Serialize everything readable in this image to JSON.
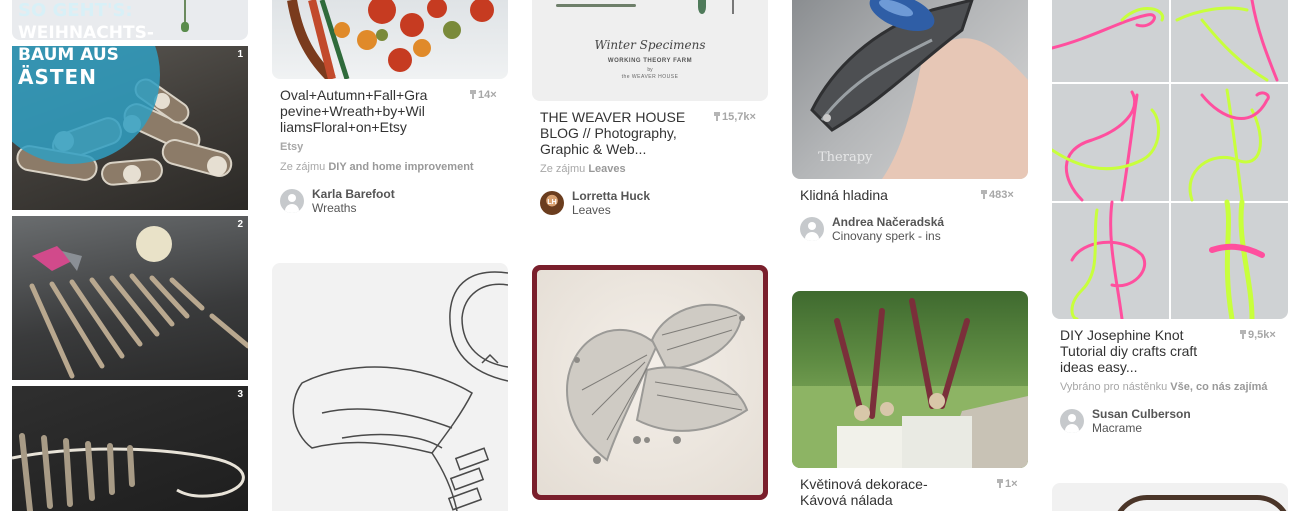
{
  "col1": {
    "badge_lines": [
      "SO GEHT'S:",
      "WEIHNACHTS-",
      "BAUM AUS",
      "ÄSTEN"
    ],
    "step1": "1",
    "step2": "2",
    "step3": "3"
  },
  "pin_wreath": {
    "title_lines": [
      "Oval+Autumn+Fall+Gra",
      "pevine+Wreath+by+Wil",
      "liamsFloral+on+Etsy"
    ],
    "repins": "14×",
    "source": "Etsy",
    "interest_prefix": "Ze zájmu",
    "interest": "DIY and home improvement",
    "user": "Karla Barefoot",
    "board": "Wreaths"
  },
  "pin_weaver": {
    "image_caption": "Winter Specimens",
    "image_sub": "WORKING THEORY FARM",
    "image_by": "by",
    "image_author": "the WEAVER HOUSE",
    "title_lines": [
      "THE WEAVER HOUSE",
      "BLOG // Photography,",
      "Graphic & Web..."
    ],
    "repins": "15,7k×",
    "interest_prefix": "Ze zájmu",
    "interest": "Leaves",
    "user": "Lorretta Huck",
    "board": "Leaves",
    "avatar_text": "LH"
  },
  "pin_hladina": {
    "watermark": "Therapy",
    "title": "Klidná hladina",
    "repins": "483×",
    "user": "Andrea Načeradská",
    "board": "Cinovany sperk - ins"
  },
  "pin_knot": {
    "title_lines": [
      "DIY Josephine Knot",
      "Tutorial diy crafts craft",
      "ideas easy..."
    ],
    "repins": "9,5k×",
    "picked_prefix": "Vybráno pro nástěnku",
    "picked": "Vše, co nás zajímá",
    "user": "Susan Culberson",
    "board": "Macrame"
  },
  "pin_dekorace": {
    "title_lines": [
      "Květinová dekorace-",
      "Kávová nálada"
    ],
    "repins": "1×"
  },
  "colors": {
    "badge": "#2f9fc2",
    "text": "#333333",
    "muted": "#a7a7a7",
    "neon_pink": "#ff4f9e",
    "neon_green": "#c8ff3c"
  }
}
